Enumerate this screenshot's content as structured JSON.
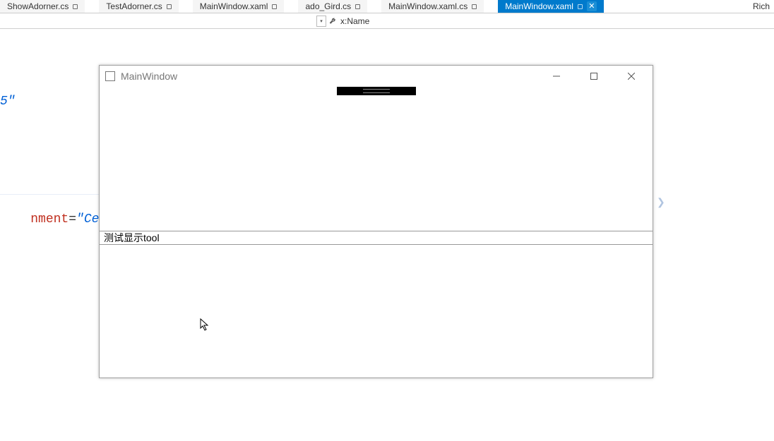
{
  "tabs": [
    {
      "label": "ShowAdorner.cs",
      "pinned": true,
      "active": false,
      "close": false
    },
    {
      "label": "TestAdorner.cs",
      "pinned": true,
      "active": false,
      "close": false
    },
    {
      "label": "MainWindow.xaml",
      "pinned": true,
      "active": false,
      "close": false
    },
    {
      "label": "ado_Gird.cs",
      "pinned": true,
      "active": false,
      "close": false
    },
    {
      "label": "MainWindow.xaml.cs",
      "pinned": true,
      "active": false,
      "close": false
    },
    {
      "label": "MainWindow.xaml",
      "pinned": true,
      "active": true,
      "close": true
    }
  ],
  "tabRight": {
    "label": "Rich"
  },
  "subbar": {
    "text": "x:Name"
  },
  "codeBg": {
    "num": "5\"",
    "attr": "nment",
    "sym": "=",
    "val": "\"Center\""
  },
  "appWindow": {
    "title": "MainWindow",
    "inputValue": "测试显示tool"
  }
}
